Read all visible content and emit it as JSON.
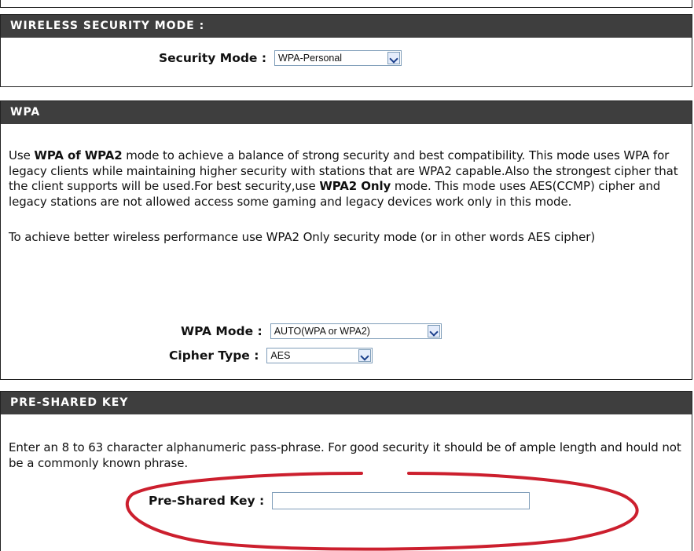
{
  "wireless": {
    "title": "WIRELESS SECURITY MODE :",
    "security_mode_label": "Security Mode :",
    "security_mode_value": "WPA-Personal"
  },
  "wpa": {
    "title": "WPA",
    "p1_a": "Use ",
    "p1_b": "WPA of WPA2",
    "p1_c": " mode to achieve a balance of strong security and best compatibility. This mode uses WPA for legacy clients while maintaining higher security with stations that are WPA2 capable.Also the strongest cipher that the client supports will be used.For best security,use ",
    "p1_d": "WPA2 Only",
    "p1_e": " mode. This mode uses AES(CCMP) cipher and legacy stations are not allowed access some gaming and legacy devices work only in this mode.",
    "p2": "To achieve better wireless performance use WPA2 Only security mode (or in other words AES cipher)",
    "wpa_mode_label": "WPA Mode :",
    "wpa_mode_value": "AUTO(WPA or WPA2)",
    "cipher_type_label": "Cipher Type :",
    "cipher_type_value": "AES"
  },
  "psk": {
    "title": "PRE-SHARED KEY",
    "description": "Enter an 8 to 63 character alphanumeric pass-phrase. For good security it should be of ample length and hould not be a commonly known phrase.",
    "key_label": "Pre-Shared Key :",
    "key_value": ""
  },
  "colors": {
    "header_bg": "#3e3e3e",
    "annotation": "#cc1f2e"
  }
}
